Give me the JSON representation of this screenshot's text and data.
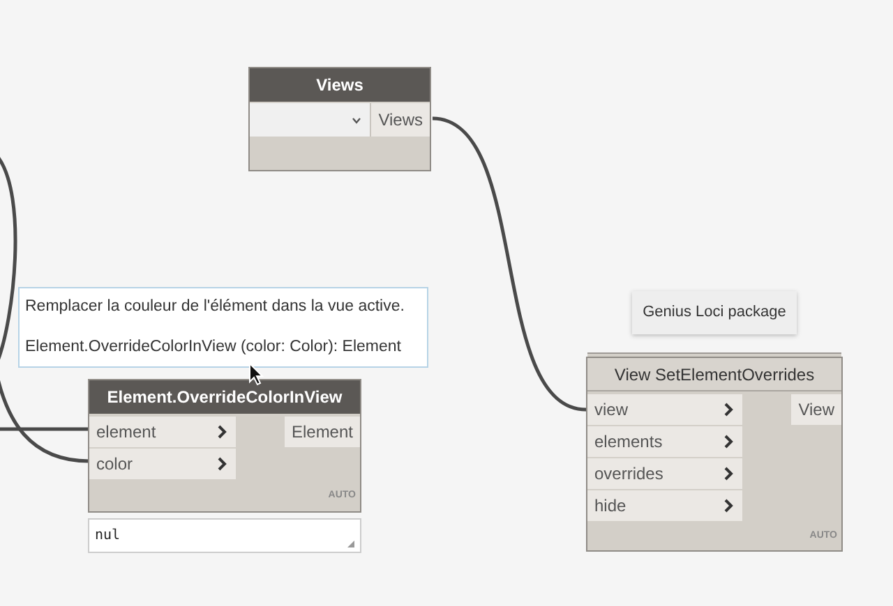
{
  "nodes": [
    {
      "kind": "dropdown",
      "title": "Views",
      "outputs": [
        "Views"
      ]
    },
    {
      "kind": "function",
      "title": "Element.OverrideColorInView",
      "inputs": [
        "element",
        "color"
      ],
      "outputs": [
        "Element"
      ],
      "lacing": "AUTO",
      "code_value": "nul",
      "tooltip": {
        "description": "Remplacer la couleur de l'élément dans la vue active.",
        "signature": "Element.OverrideColorInView (color: Color): Element"
      }
    },
    {
      "kind": "package",
      "title": "View SetElementOverrides",
      "inputs": [
        "view",
        "elements",
        "overrides",
        "hide"
      ],
      "outputs": [
        "View"
      ],
      "lacing": "AUTO",
      "package_label": "Genius Loci package"
    }
  ]
}
